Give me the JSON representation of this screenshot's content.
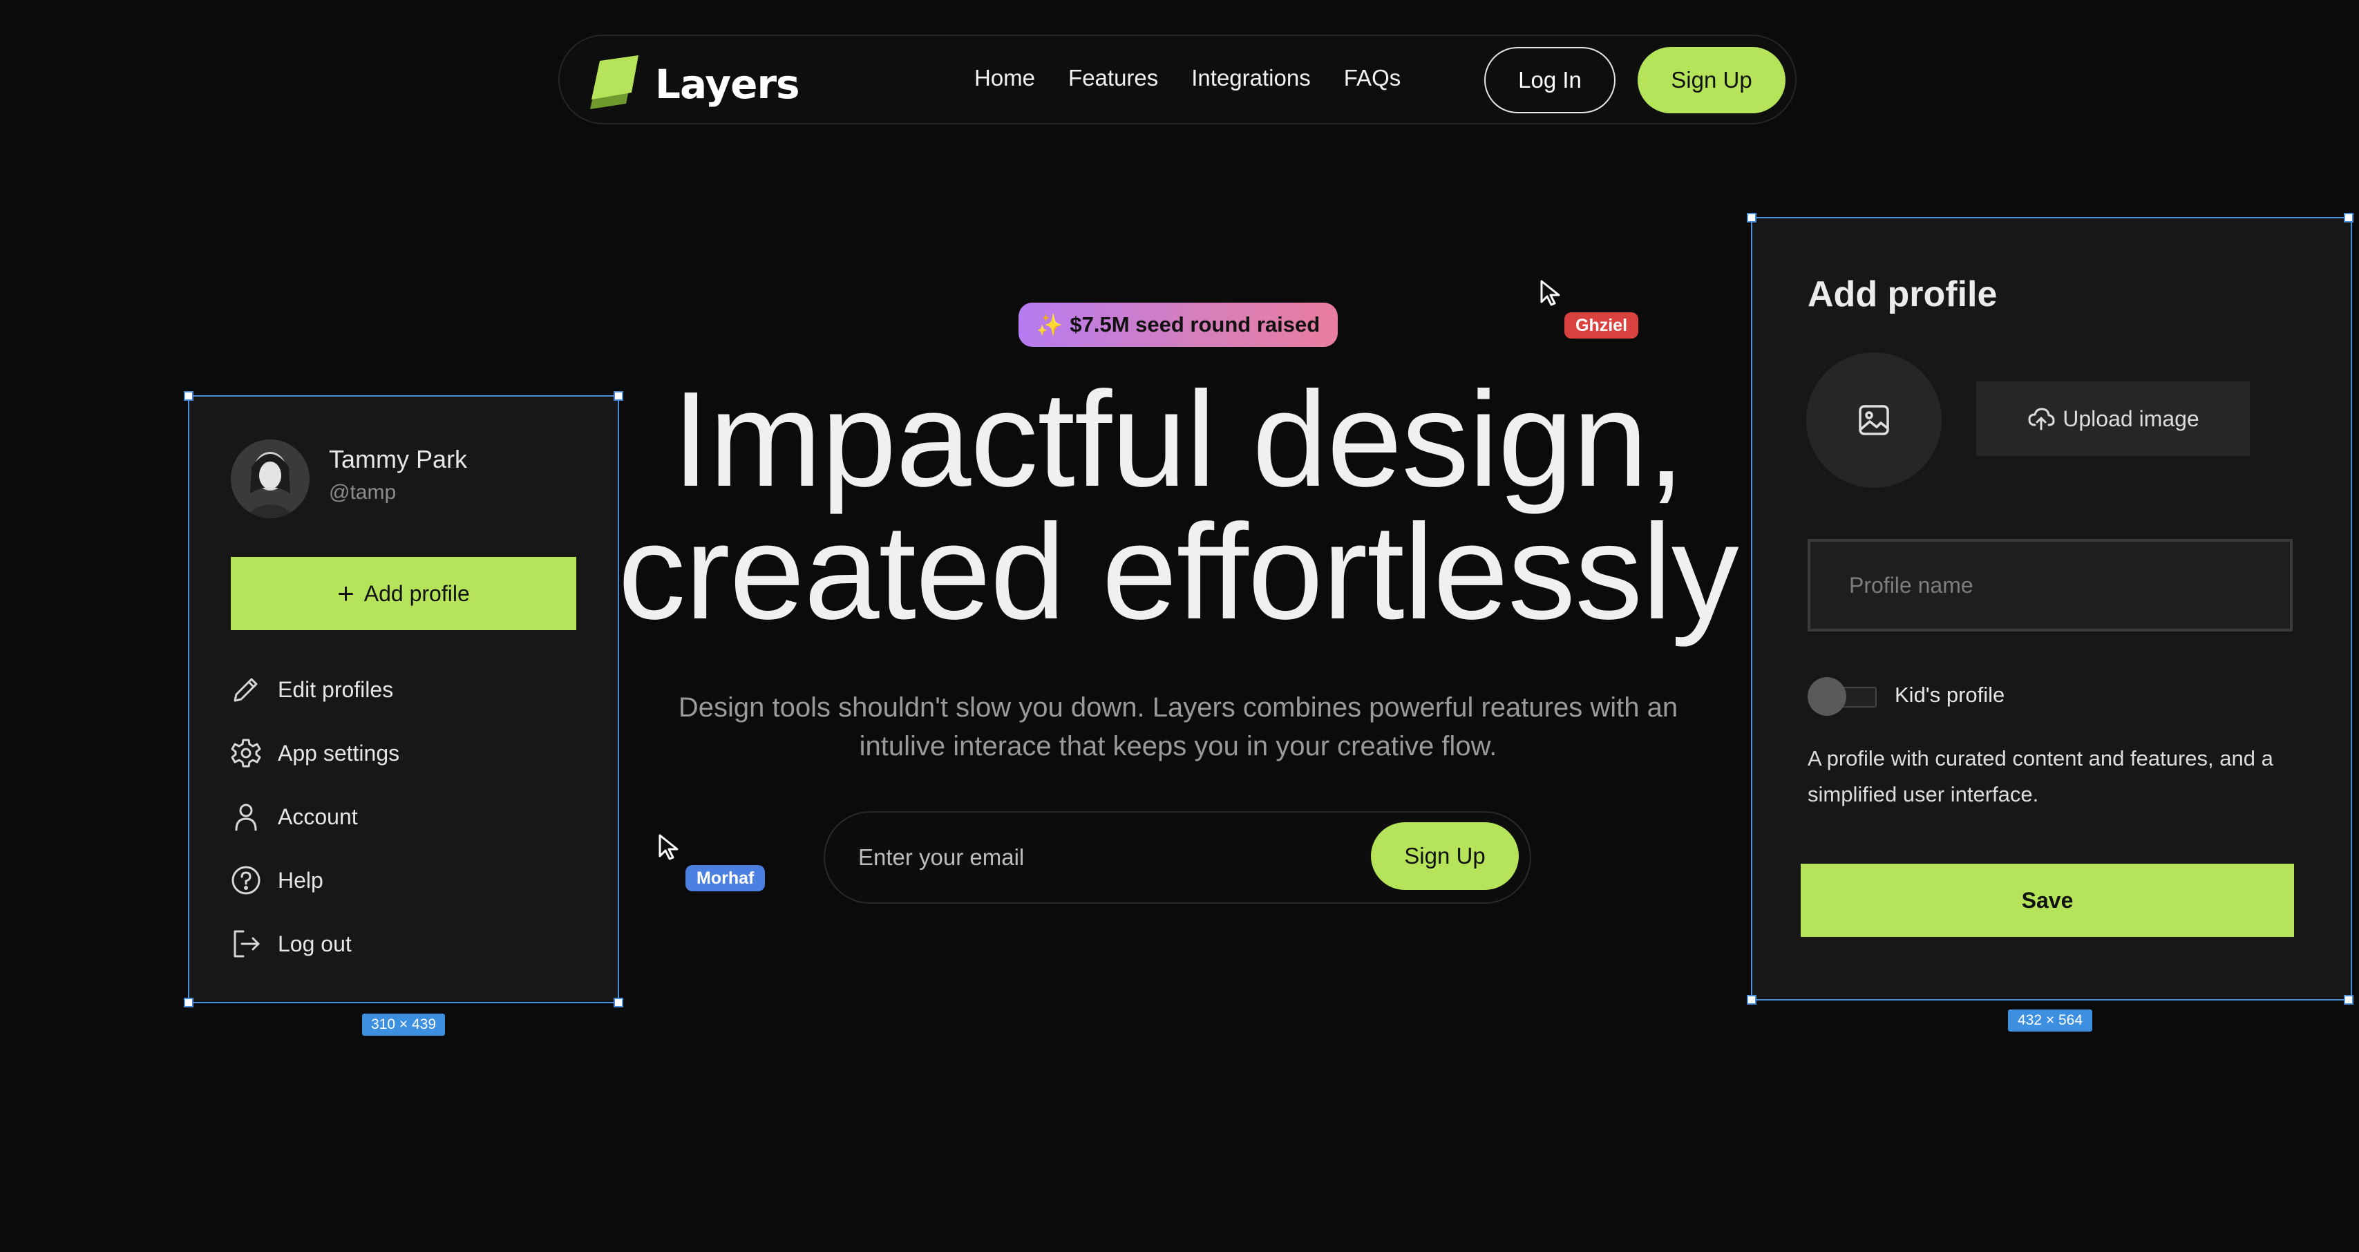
{
  "colors": {
    "accent": "#b5e45a",
    "background": "#0b0b0b",
    "card": "#171717",
    "selection": "#4a8ed8",
    "badge_gradient": [
      "#b67cf2",
      "#ea7ea0"
    ],
    "cursor_ghziel": "#d9423f",
    "cursor_morhaf": "#4b7fe0"
  },
  "nav": {
    "logo_icon": "layers-logo-icon",
    "logo_text": "Layers",
    "links": [
      "Home",
      "Features",
      "Integrations",
      "FAQs"
    ],
    "login_label": "Log In",
    "signup_label": "Sign Up"
  },
  "hero": {
    "badge_icon": "sparkles-icon",
    "badge_text": "$7.5M seed round raised",
    "headline_line1": "Impactful design,",
    "headline_line2": "created effortlessly",
    "subtext": "Design tools shouldn't slow you down. Layers combines powerful reatures with an intulive interace that keeps you in your creative flow.",
    "email_placeholder": "Enter your email",
    "signup_label": "Sign Up"
  },
  "cursors": {
    "ghziel": "Ghziel",
    "morhaf": "Morhaf"
  },
  "profile_menu": {
    "dimensions": "310 × 439",
    "user_name": "Tammy Park",
    "user_handle": "@tamp",
    "add_profile_label": "Add profile",
    "items": [
      {
        "icon": "pencil-icon",
        "label": "Edit profiles"
      },
      {
        "icon": "gear-icon",
        "label": "App settings"
      },
      {
        "icon": "user-icon",
        "label": "Account"
      },
      {
        "icon": "help-circle-icon",
        "label": "Help"
      },
      {
        "icon": "logout-icon",
        "label": "Log out"
      }
    ]
  },
  "add_profile_form": {
    "dimensions": "432 × 564",
    "title": "Add profile",
    "image_placeholder_icon": "image-icon",
    "upload_icon": "cloud-upload-icon",
    "upload_label": "Upload image",
    "name_placeholder": "Profile name",
    "kids_toggle_label": "Kid's profile",
    "kids_toggle_on": false,
    "description": "A profile with curated content and features, and a simplified user interface.",
    "save_label": "Save"
  }
}
